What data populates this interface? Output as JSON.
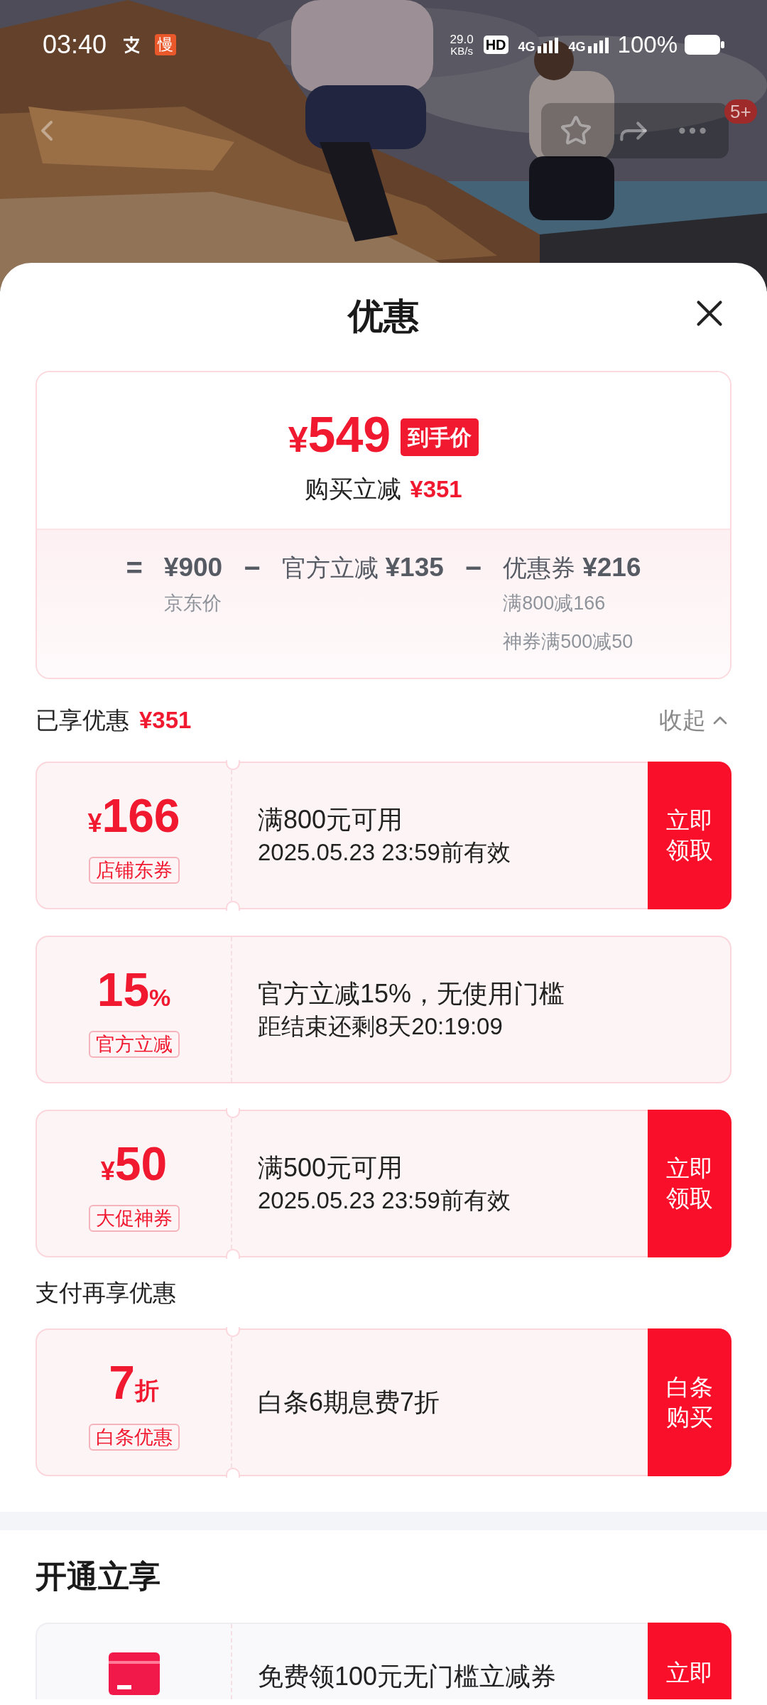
{
  "status_bar": {
    "time": "03:40",
    "notice_char": "慢",
    "speed": "29.0",
    "speed_unit": "KB/s",
    "hd": "HD",
    "sim_labels": [
      "4G",
      "4G"
    ],
    "battery": "100%"
  },
  "nav": {
    "badge": "5+"
  },
  "sheet": {
    "title": "优惠"
  },
  "summary": {
    "currency": "¥",
    "price": "549",
    "price_tag": "到手价",
    "saving_label": "购买立减",
    "saving": "¥351",
    "breakdown": [
      {
        "op": "=",
        "amount": "¥900",
        "notes": [
          "京东价"
        ]
      },
      {
        "op": "−",
        "label": "官方立减",
        "amount": "¥135"
      },
      {
        "op": "−",
        "label": "优惠券",
        "amount": "¥216",
        "notes": [
          "满800减166",
          "神券满500减50"
        ]
      }
    ]
  },
  "enjoyed": {
    "label": "已享优惠",
    "amount": "¥351",
    "toggle": "收起",
    "expanded": true
  },
  "coupons": [
    {
      "prefix": "¥",
      "value": "166",
      "tag": "店铺东券",
      "title": "满800元可用",
      "subtitle": "2025.05.23 23:59前有效",
      "action": "立即领取"
    },
    {
      "value": "15",
      "suffix": "%",
      "tag": "官方立减",
      "title": "官方立减15%，无使用门槛",
      "subtitle": "距结束还剩8天20:19:09"
    },
    {
      "prefix": "¥",
      "value": "50",
      "tag": "大促神券",
      "title": "满500元可用",
      "subtitle": "2025.05.23 23:59前有效",
      "action": "立即领取"
    }
  ],
  "pay_section": {
    "title": "支付再享优惠",
    "offers": [
      {
        "value": "7",
        "suffix": "折",
        "tag": "白条优惠",
        "title": "白条6期息费7折",
        "action": "白条购买"
      }
    ]
  },
  "open_section": {
    "title": "开通立享",
    "offers": [
      {
        "kind": "card_icon",
        "title": "免费领100元无门槛立减券",
        "action": "立即"
      }
    ]
  }
}
